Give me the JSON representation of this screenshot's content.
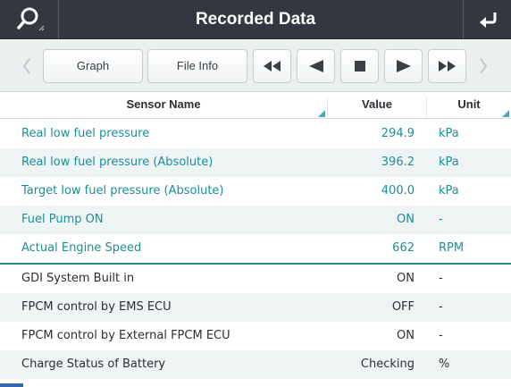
{
  "header": {
    "title": "Recorded Data",
    "left_icon": "search-icon",
    "right_icon": "back-arrow-icon"
  },
  "toolbar": {
    "graph_label": "Graph",
    "file_info_label": "File Info",
    "icons": [
      "chevron-left-icon",
      "rewind-icon",
      "step-back-icon",
      "stop-icon",
      "play-icon",
      "fast-forward-icon",
      "chevron-right-icon"
    ]
  },
  "table": {
    "headers": {
      "name": "Sensor Name",
      "value": "Value",
      "unit": "Unit"
    },
    "rows": [
      {
        "name": "Real low fuel pressure",
        "value": "294.9",
        "unit": "kPa"
      },
      {
        "name": "Real low fuel pressure (Absolute)",
        "value": "396.2",
        "unit": "kPa"
      },
      {
        "name": "Target low fuel pressure (Absolute)",
        "value": "400.0",
        "unit": "kPa"
      },
      {
        "name": "Fuel Pump ON",
        "value": "ON",
        "unit": "-"
      },
      {
        "name": "Actual Engine Speed",
        "value": "662",
        "unit": "RPM"
      },
      {
        "name": "GDI System Built in",
        "value": "ON",
        "unit": "-"
      },
      {
        "name": "FPCM control by EMS ECU",
        "value": "OFF",
        "unit": "-"
      },
      {
        "name": "FPCM control by External FPCM ECU",
        "value": "ON",
        "unit": "-"
      },
      {
        "name": "Charge Status of Battery",
        "value": "Checking",
        "unit": "%"
      }
    ]
  },
  "colors": {
    "titlebar": "#333840",
    "accent_teal": "#1a8f98",
    "row_alt": "#eef3f3"
  }
}
